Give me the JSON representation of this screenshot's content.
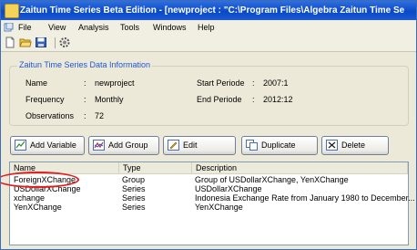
{
  "window": {
    "title": "Zaitun Time Series Beta Edition - [newproject : \"C:\\Program Files\\Algebra Zaitun Time Se"
  },
  "menu": [
    {
      "label": "File"
    },
    {
      "label": "View"
    },
    {
      "label": "Analysis"
    },
    {
      "label": "Tools"
    },
    {
      "label": "Windows"
    },
    {
      "label": "Help"
    }
  ],
  "toolbar": {
    "icons": [
      "new-document-icon",
      "open-folder-icon",
      "save-icon",
      "settings-gear-icon"
    ]
  },
  "info": {
    "group_title": "Zaitun Time Series Data Information",
    "name_label": "Name",
    "name_value": "newproject",
    "frequency_label": "Frequency",
    "frequency_value": "Monthly",
    "observations_label": "Observations",
    "observations_value": "72",
    "start_label": "Start Periode",
    "start_value": "2007:1",
    "end_label": "End Periode",
    "end_value": "2012:12",
    "separator": ":"
  },
  "buttons": {
    "add_variable": "Add Variable",
    "add_group": "Add Group",
    "edit": "Edit",
    "duplicate": "Duplicate",
    "delete": "Delete"
  },
  "list": {
    "columns": [
      "Name",
      "Type",
      "Description"
    ],
    "rows": [
      {
        "name": "ForeignXChange",
        "type": "Group",
        "description": "Group of USDollarXChange, YenXChange"
      },
      {
        "name": "USDollarXChange",
        "type": "Series",
        "description": "USDollarXChange"
      },
      {
        "name": "xchange",
        "type": "Series",
        "description": "Indonesia Exchange Rate from January 1980 to December..."
      },
      {
        "name": "YenXChange",
        "type": "Series",
        "description": "YenXChange"
      }
    ]
  },
  "colors": {
    "title_bar": "#0a49c6",
    "group_title": "#1f56d8",
    "highlight_ellipse": "#e02020"
  }
}
